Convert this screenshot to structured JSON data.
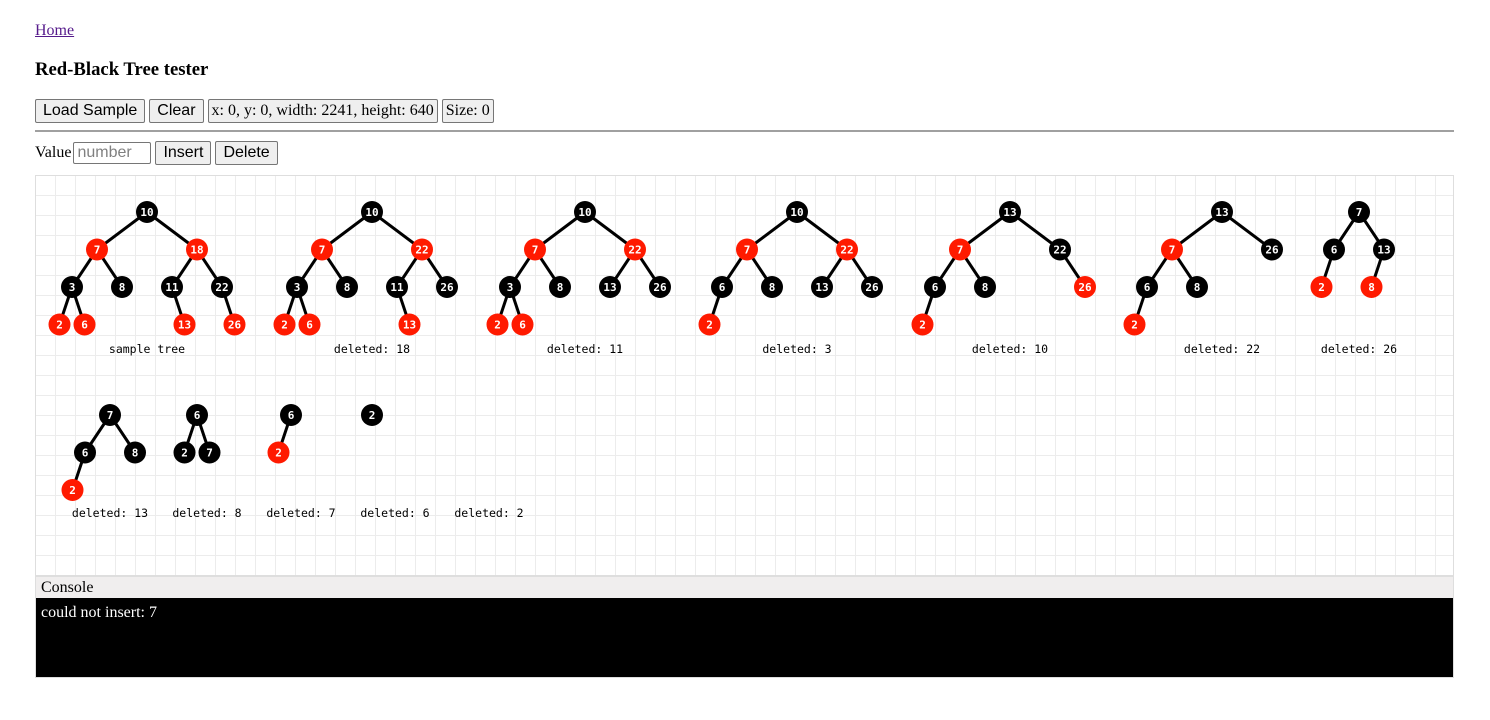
{
  "nav": {
    "home_link": "Home"
  },
  "page": {
    "title": "Red-Black Tree tester"
  },
  "toolbar": {
    "load_sample": "Load Sample",
    "clear": "Clear",
    "viewport_info": "x: 0, y: 0, width: 2241, height: 640",
    "size_info": "Size: 0"
  },
  "value_row": {
    "label": "Value",
    "input_value": "",
    "input_placeholder": "number",
    "insert": "Insert",
    "delete": "Delete"
  },
  "colors": {
    "red_node": "#ff1a00",
    "black_node": "#000000",
    "edge": "#000000",
    "grid": "#ececec"
  },
  "trees": [
    {
      "caption": "sample tree",
      "row": 0,
      "root": {
        "v": 10,
        "c": "b",
        "l": {
          "v": 7,
          "c": "r",
          "l": {
            "v": 3,
            "c": "b",
            "l": {
              "v": 2,
              "c": "r"
            },
            "r": {
              "v": 6,
              "c": "r"
            }
          },
          "r": {
            "v": 8,
            "c": "b"
          }
        },
        "r": {
          "v": 18,
          "c": "r",
          "l": {
            "v": 11,
            "c": "b",
            "r": {
              "v": 13,
              "c": "r"
            }
          },
          "r": {
            "v": 22,
            "c": "b",
            "r": {
              "v": 26,
              "c": "r"
            }
          }
        }
      }
    },
    {
      "caption": "deleted: 18",
      "row": 0,
      "root": {
        "v": 10,
        "c": "b",
        "l": {
          "v": 7,
          "c": "r",
          "l": {
            "v": 3,
            "c": "b",
            "l": {
              "v": 2,
              "c": "r"
            },
            "r": {
              "v": 6,
              "c": "r"
            }
          },
          "r": {
            "v": 8,
            "c": "b"
          }
        },
        "r": {
          "v": 22,
          "c": "r",
          "l": {
            "v": 11,
            "c": "b",
            "r": {
              "v": 13,
              "c": "r"
            }
          },
          "r": {
            "v": 26,
            "c": "b"
          }
        }
      }
    },
    {
      "caption": "deleted: 11",
      "row": 0,
      "root": {
        "v": 10,
        "c": "b",
        "l": {
          "v": 7,
          "c": "r",
          "l": {
            "v": 3,
            "c": "b",
            "l": {
              "v": 2,
              "c": "r"
            },
            "r": {
              "v": 6,
              "c": "r"
            }
          },
          "r": {
            "v": 8,
            "c": "b"
          }
        },
        "r": {
          "v": 22,
          "c": "r",
          "l": {
            "v": 13,
            "c": "b"
          },
          "r": {
            "v": 26,
            "c": "b"
          }
        }
      }
    },
    {
      "caption": "deleted: 3",
      "row": 0,
      "root": {
        "v": 10,
        "c": "b",
        "l": {
          "v": 7,
          "c": "r",
          "l": {
            "v": 6,
            "c": "b",
            "l": {
              "v": 2,
              "c": "r"
            }
          },
          "r": {
            "v": 8,
            "c": "b"
          }
        },
        "r": {
          "v": 22,
          "c": "r",
          "l": {
            "v": 13,
            "c": "b"
          },
          "r": {
            "v": 26,
            "c": "b"
          }
        }
      }
    },
    {
      "caption": "deleted: 10",
      "row": 0,
      "root": {
        "v": 13,
        "c": "b",
        "l": {
          "v": 7,
          "c": "r",
          "l": {
            "v": 6,
            "c": "b",
            "l": {
              "v": 2,
              "c": "r"
            }
          },
          "r": {
            "v": 8,
            "c": "b"
          }
        },
        "r": {
          "v": 22,
          "c": "b",
          "r": {
            "v": 26,
            "c": "r"
          }
        }
      }
    },
    {
      "caption": "deleted: 22",
      "row": 0,
      "root": {
        "v": 13,
        "c": "b",
        "l": {
          "v": 7,
          "c": "r",
          "l": {
            "v": 6,
            "c": "b",
            "l": {
              "v": 2,
              "c": "r"
            }
          },
          "r": {
            "v": 8,
            "c": "b"
          }
        },
        "r": {
          "v": 26,
          "c": "b"
        }
      }
    },
    {
      "caption": "deleted: 26",
      "row": 0,
      "root": {
        "v": 7,
        "c": "b",
        "l": {
          "v": 6,
          "c": "b",
          "l": {
            "v": 2,
            "c": "r"
          }
        },
        "r": {
          "v": 13,
          "c": "b",
          "l": {
            "v": 8,
            "c": "r"
          }
        }
      }
    },
    {
      "caption": "deleted: 13",
      "row": 1,
      "root": {
        "v": 7,
        "c": "b",
        "l": {
          "v": 6,
          "c": "b",
          "l": {
            "v": 2,
            "c": "r"
          }
        },
        "r": {
          "v": 8,
          "c": "b"
        }
      }
    },
    {
      "caption": "deleted: 8",
      "row": 1,
      "root": {
        "v": 6,
        "c": "b",
        "l": {
          "v": 2,
          "c": "b"
        },
        "r": {
          "v": 7,
          "c": "b"
        }
      }
    },
    {
      "caption": "deleted: 7",
      "row": 1,
      "root": {
        "v": 6,
        "c": "b",
        "l": {
          "v": 2,
          "c": "r"
        }
      }
    },
    {
      "caption": "deleted: 6",
      "row": 1,
      "root": {
        "v": 2,
        "c": "b"
      }
    },
    {
      "caption": "deleted: 2",
      "row": 1,
      "root": null
    }
  ],
  "console": {
    "header": "Console",
    "lines": [
      "could not insert: 7"
    ]
  }
}
